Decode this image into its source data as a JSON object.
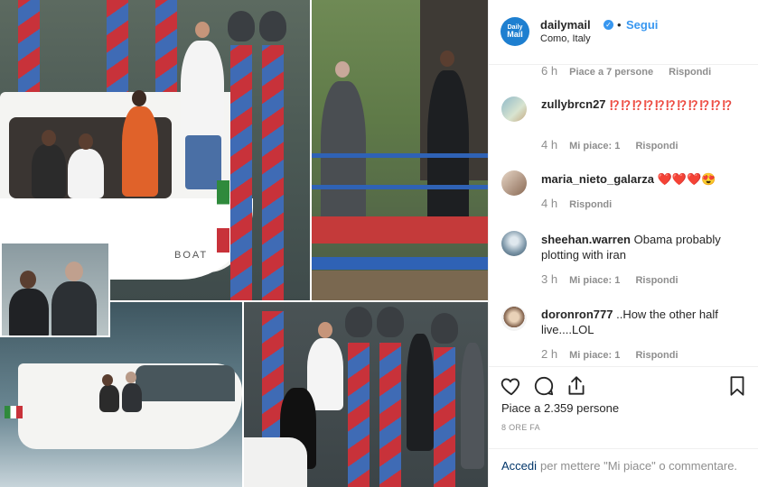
{
  "post": {
    "account": "dailymail",
    "avatar_text_line1": "Daily",
    "avatar_text_line2": "Mail",
    "separator": "•",
    "follow_label": "Segui",
    "location": "Como, Italy",
    "photo_boat_label": "BOAT"
  },
  "comments": [
    {
      "user": "",
      "text": "",
      "time": "6 h",
      "likes": "Piace a 7 persone",
      "reply": "Rispondi"
    },
    {
      "user": "zullybrcn27",
      "text": "⁉️⁉️⁉️⁉️⁉️⁉️⁉️⁉️⁉️⁉️⁉️",
      "time": "4 h",
      "likes": "Mi piace: 1",
      "reply": "Rispondi"
    },
    {
      "user": "maria_nieto_galarza",
      "text": "❤️❤️❤️😍",
      "time": "4 h",
      "likes": "",
      "reply": "Rispondi"
    },
    {
      "user": "sheehan.warren",
      "text": "Obama probably plotting with iran",
      "time": "3 h",
      "likes": "Mi piace: 1",
      "reply": "Rispondi"
    },
    {
      "user": "doronron777",
      "text": "..How the other half live....LOL",
      "time": "2 h",
      "likes": "Mi piace: 1",
      "reply": "Rispondi"
    }
  ],
  "actions": {
    "like_icon": "heart-icon",
    "comment_icon": "comment-bubble-icon",
    "share_icon": "share-icon",
    "save_icon": "bookmark-icon",
    "likes_total": "Piace a 2.359 persone",
    "time_ago": "8 ORE FA",
    "login_link": "Accedi",
    "login_rest": "per mettere \"Mi piace\" o commentare."
  },
  "colors": {
    "link_blue": "#3897f0",
    "meta_gray": "#8e8e8e",
    "text": "#262626",
    "border": "#efefef",
    "pole_red": "#c8323a",
    "pole_blue": "#3f6bb5"
  }
}
